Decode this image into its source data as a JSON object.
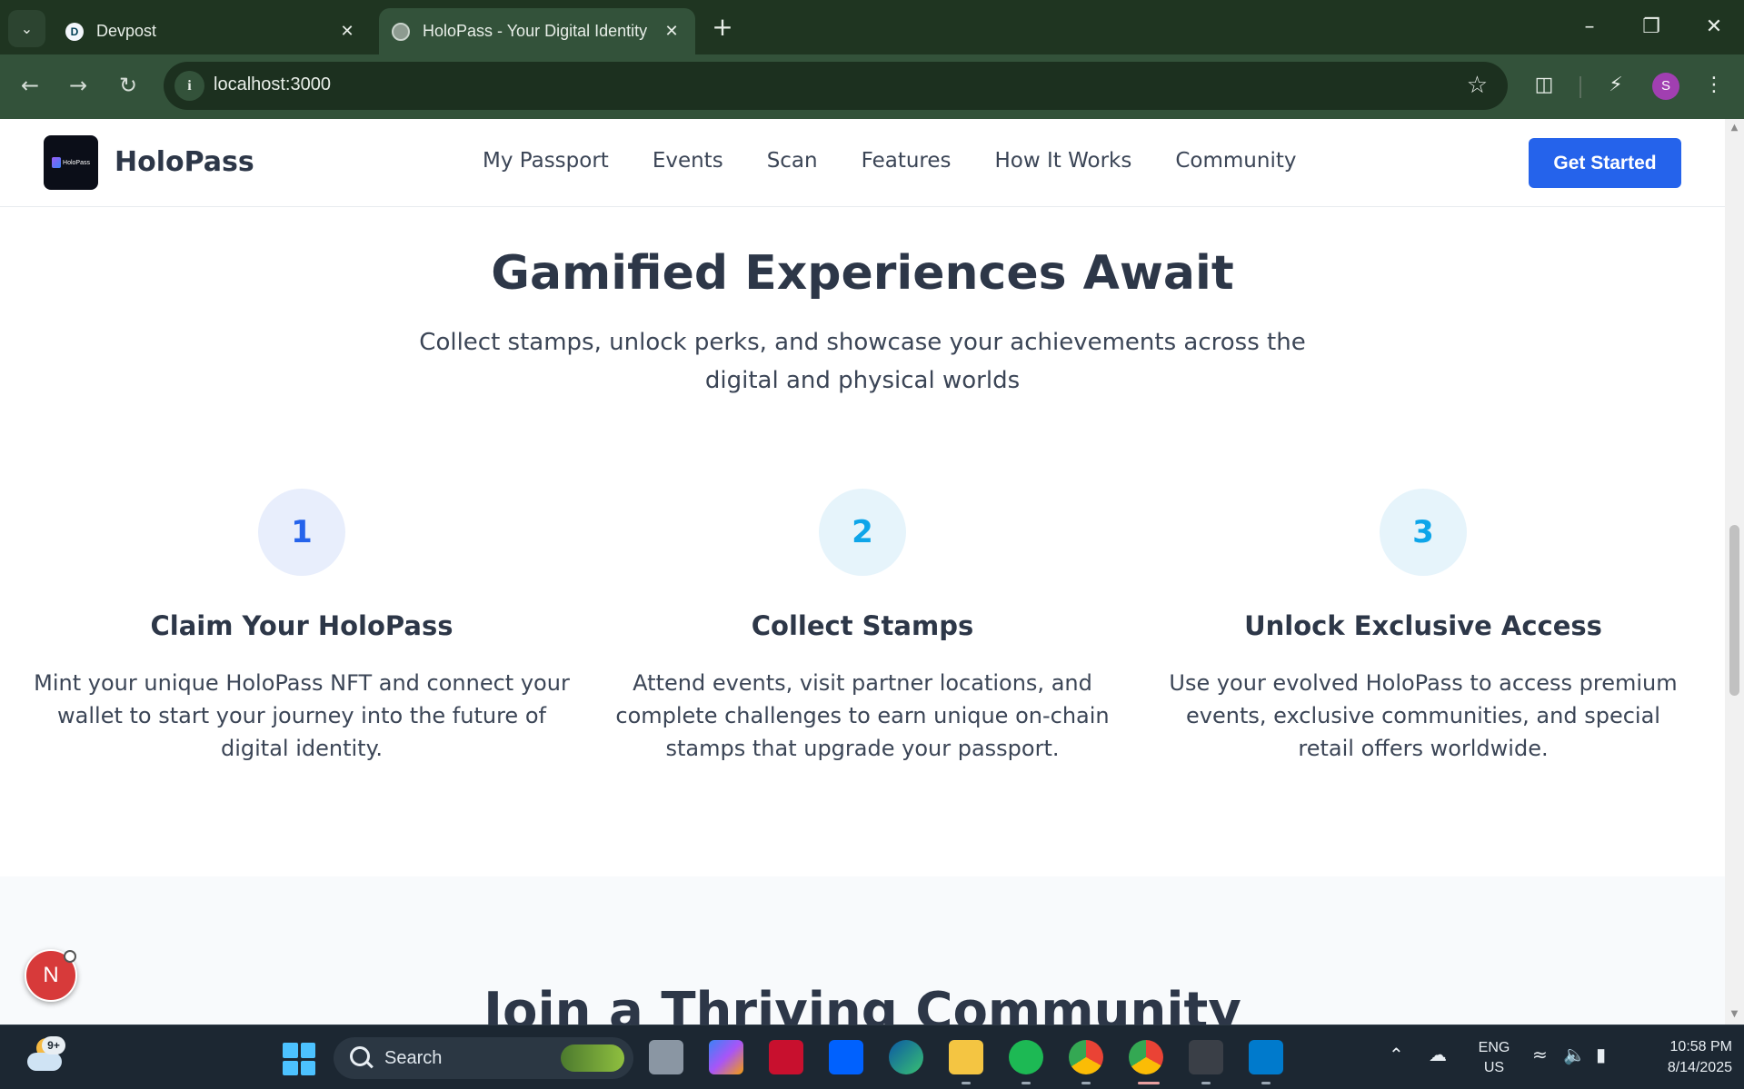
{
  "browser": {
    "tabs": [
      {
        "title": "Devpost",
        "favicon": "D"
      },
      {
        "title": "HoloPass - Your Digital Identity",
        "favicon": "globe-icon"
      }
    ],
    "url": "localhost:3000",
    "profile_initial": "S"
  },
  "site": {
    "logo_text": "HoloPass",
    "brand": "HoloPass",
    "nav": [
      "My Passport",
      "Events",
      "Scan",
      "Features",
      "How It Works",
      "Community"
    ],
    "cta": "Get Started"
  },
  "section": {
    "title": "Gamified Experiences Await",
    "subtitle": "Collect stamps, unlock perks, and showcase your achievements across the digital and physical worlds",
    "steps": [
      {
        "number": "1",
        "title": "Claim Your HoloPass",
        "description": "Mint your unique HoloPass NFT and connect your wallet to start your journey into the future of digital identity.",
        "color": "#2563eb",
        "bg": "#e8eefc"
      },
      {
        "number": "2",
        "title": "Collect Stamps",
        "description": "Attend events, visit partner locations, and complete challenges to earn unique on-chain stamps that upgrade your passport.",
        "color": "#0ea5e9",
        "bg": "#e6f4fb"
      },
      {
        "number": "3",
        "title": "Unlock Exclusive Access",
        "description": "Use your evolved HoloPass to access premium events, exclusive communities, and special retail offers worldwide.",
        "color": "#0ea5e9",
        "bg": "#e6f4fb"
      }
    ]
  },
  "next_section": {
    "title": "Join a Thriving Community"
  },
  "dev_badge": "N",
  "taskbar": {
    "weather_badge": "9+",
    "search_placeholder": "Search",
    "language": [
      "ENG",
      "US"
    ],
    "time": "10:58 PM",
    "date": "8/14/2025"
  }
}
